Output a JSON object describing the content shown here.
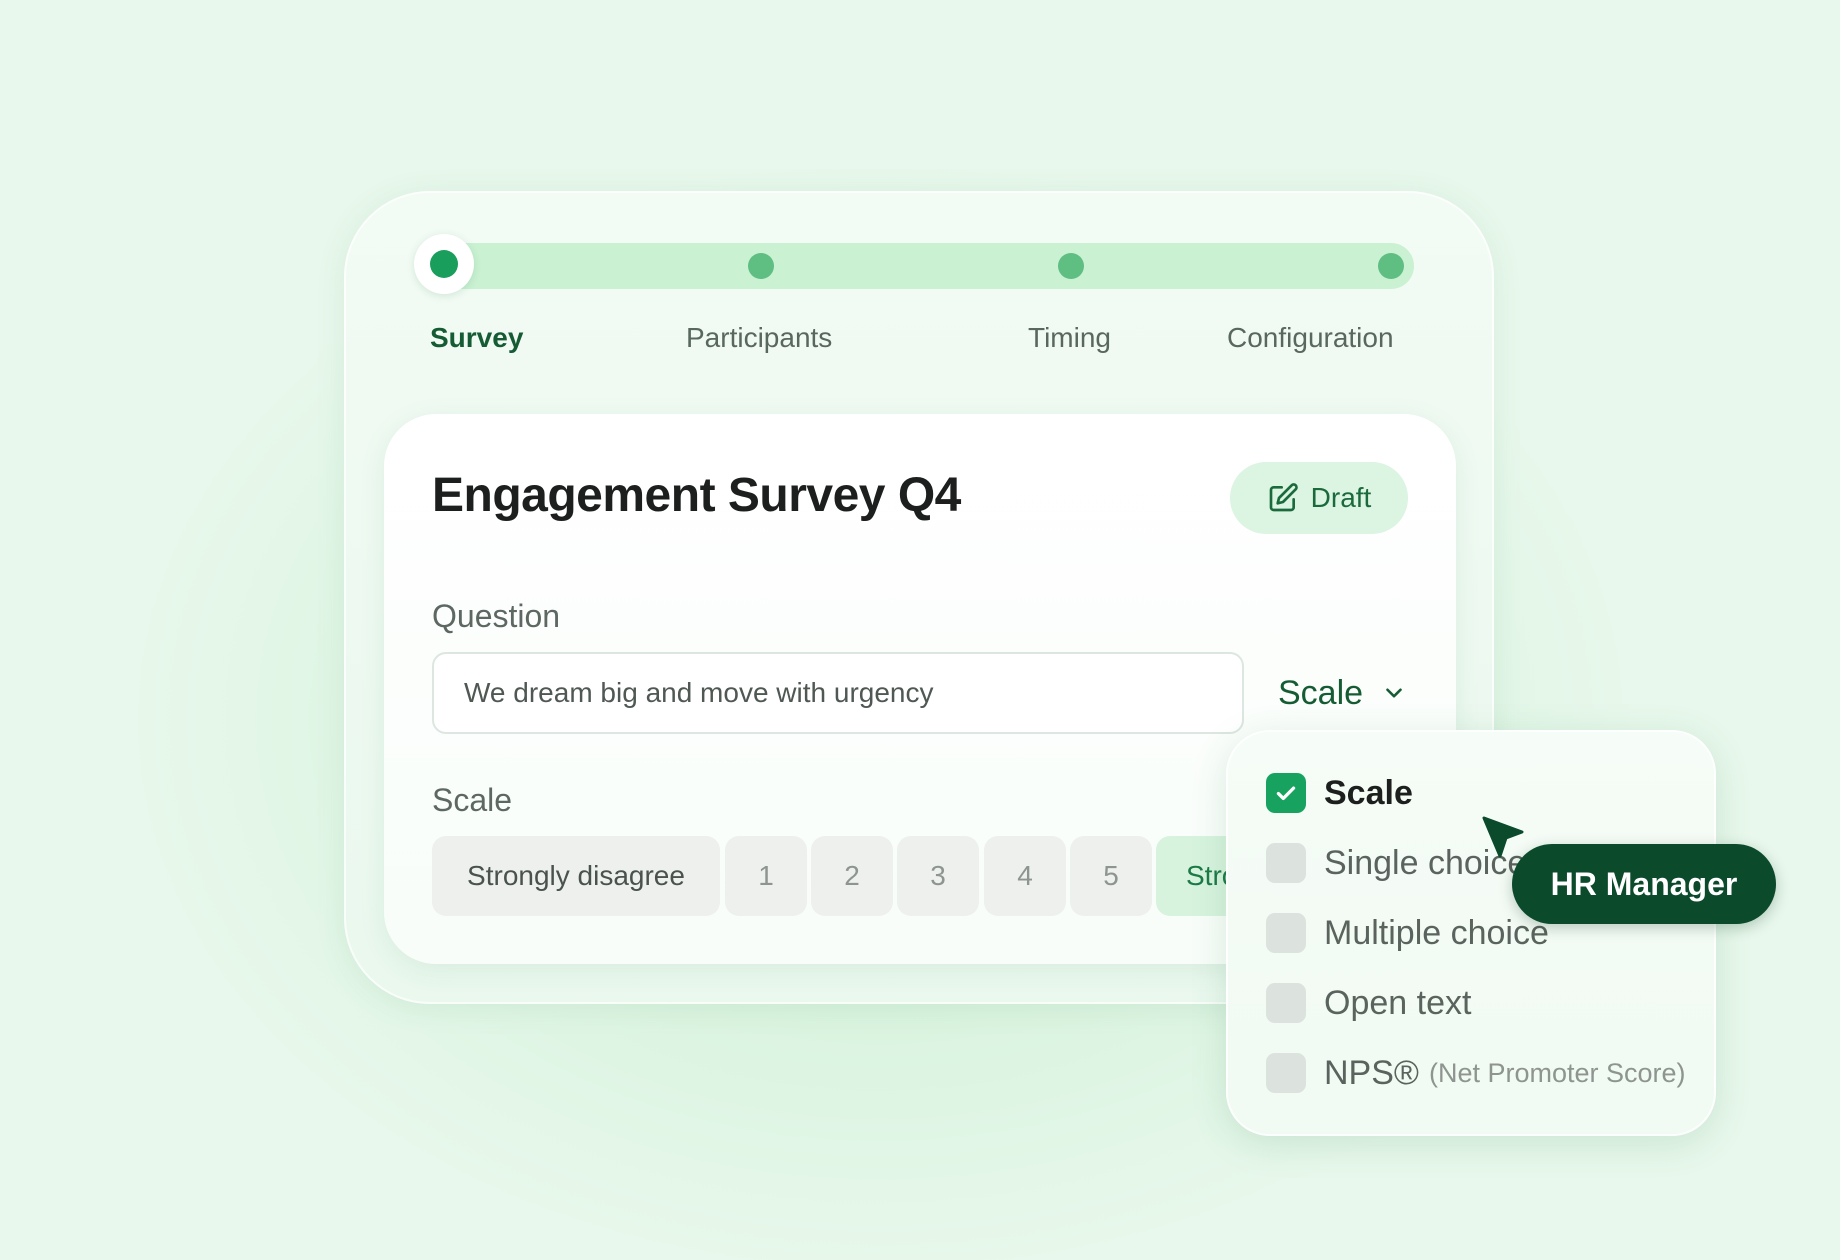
{
  "stepper": {
    "steps": [
      {
        "label": "Survey",
        "active": true
      },
      {
        "label": "Participants",
        "active": false
      },
      {
        "label": "Timing",
        "active": false
      },
      {
        "label": "Configuration",
        "active": false
      }
    ]
  },
  "survey": {
    "title": "Engagement Survey Q4",
    "status": "Draft",
    "question_label": "Question",
    "question_value": "We dream big and move with urgency",
    "question_type": "Scale"
  },
  "scale": {
    "label": "Scale",
    "low_label": "Strongly disagree",
    "points": [
      "1",
      "2",
      "3",
      "4",
      "5"
    ],
    "high_label": "Strongly agree"
  },
  "type_menu": {
    "items": [
      {
        "label": "Scale",
        "checked": true
      },
      {
        "label": "Single choice",
        "checked": false
      },
      {
        "label": "Multiple choice",
        "checked": false
      },
      {
        "label": "Open text",
        "checked": false
      },
      {
        "label": "NPS®",
        "sub": "(Net Promoter Score)",
        "checked": false
      }
    ]
  },
  "cursor": {
    "user": "HR Manager"
  },
  "colors": {
    "accent": "#17a35f",
    "brand_dark": "#0b4a2b",
    "track": "#c9f1d2",
    "background": "#e8f8ec"
  },
  "icons": {
    "draft": "edit-icon",
    "select": "chevron-down-icon",
    "check": "check-icon",
    "cursor": "pointer-cursor-icon"
  }
}
